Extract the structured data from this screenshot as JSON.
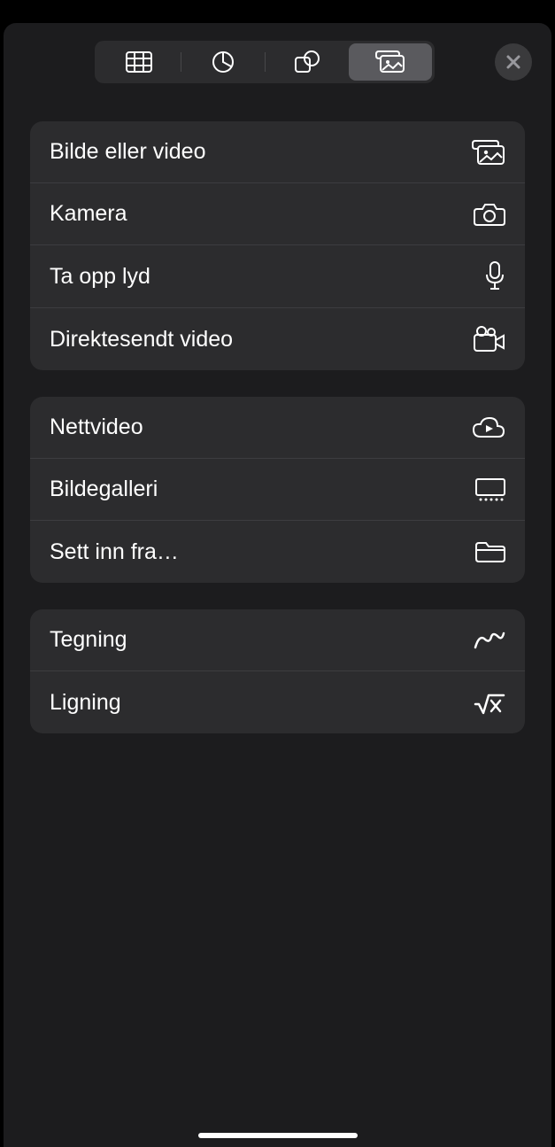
{
  "segmented": {
    "items": [
      {
        "name": "table-icon"
      },
      {
        "name": "chart-icon"
      },
      {
        "name": "shape-icon"
      },
      {
        "name": "media-icon"
      }
    ],
    "activeIndex": 3
  },
  "groups": [
    {
      "items": [
        {
          "label": "Bilde eller video",
          "icon": "photo-stack-icon"
        },
        {
          "label": "Kamera",
          "icon": "camera-icon"
        },
        {
          "label": "Ta opp lyd",
          "icon": "microphone-icon"
        },
        {
          "label": "Direktesendt video",
          "icon": "video-camera-icon"
        }
      ]
    },
    {
      "items": [
        {
          "label": "Nettvideo",
          "icon": "cloud-play-icon"
        },
        {
          "label": "Bildegalleri",
          "icon": "gallery-icon"
        },
        {
          "label": "Sett inn fra…",
          "icon": "folder-icon"
        }
      ]
    },
    {
      "items": [
        {
          "label": "Tegning",
          "icon": "scribble-icon"
        },
        {
          "label": "Ligning",
          "icon": "equation-icon"
        }
      ]
    }
  ]
}
